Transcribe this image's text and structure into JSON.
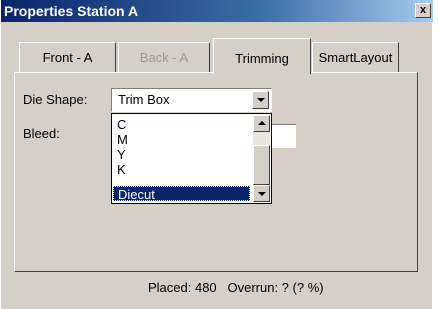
{
  "window": {
    "title": "Properties Station A",
    "close_label": "x"
  },
  "tabs": [
    {
      "label": "Front - A",
      "state": "normal"
    },
    {
      "label": "Back - A",
      "state": "disabled"
    },
    {
      "label": "Trimming",
      "state": "active"
    },
    {
      "label": "SmartLayout",
      "state": "normal"
    }
  ],
  "form": {
    "die_shape_label": "Die Shape:",
    "die_shape_value": "Trim Box",
    "bleed_label": "Bleed:",
    "bleed_value": ""
  },
  "dropdown": {
    "options": [
      "C",
      "M",
      "Y",
      "K",
      "Diecut"
    ],
    "selected": "Diecut"
  },
  "status": {
    "text": "Placed: 480   Overrun: ? (? %)"
  },
  "colors": {
    "title_start": "#0a246a",
    "title_end": "#a6caf0",
    "selection": "#0a246a",
    "face": "#d4d0c8"
  }
}
